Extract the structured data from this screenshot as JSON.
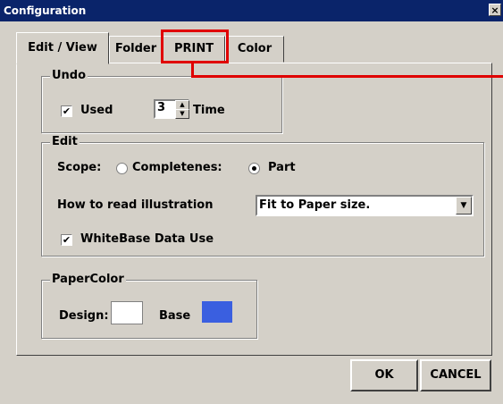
{
  "window": {
    "title": "Configuration",
    "close_glyph": "×"
  },
  "tabs": [
    {
      "label": "Edit / View",
      "active": true
    },
    {
      "label": "Folder",
      "active": false
    },
    {
      "label": "PRINT",
      "active": false,
      "highlighted": true
    },
    {
      "label": "Color",
      "active": false
    }
  ],
  "undo": {
    "legend": "Undo",
    "used_label": "Used",
    "used_checked": true,
    "times_value": "3",
    "times_label": "Time"
  },
  "edit": {
    "legend": "Edit",
    "scope_label": "Scope:",
    "scope_options": [
      {
        "label": "Completenes:",
        "selected": false
      },
      {
        "label": "Part",
        "selected": true
      }
    ],
    "read_label": "How to read illustration",
    "read_value": "Fit to Paper size.",
    "whitebase_label": "WhiteBase Data Use",
    "whitebase_checked": true
  },
  "paper_color": {
    "legend": "PaperColor",
    "design_label": "Design:",
    "design_color": "#ffffff",
    "base_label": "Base",
    "base_color": "#3a5fe0"
  },
  "buttons": {
    "ok": "OK",
    "cancel": "CANCEL"
  },
  "colors": {
    "dialog_bg": "#d4d0c8",
    "title_bar": "#0a246a",
    "highlight": "#e00000"
  },
  "icons": {
    "check": "✔",
    "spin_up": "▲",
    "spin_down": "▼",
    "dropdown": "▼"
  }
}
